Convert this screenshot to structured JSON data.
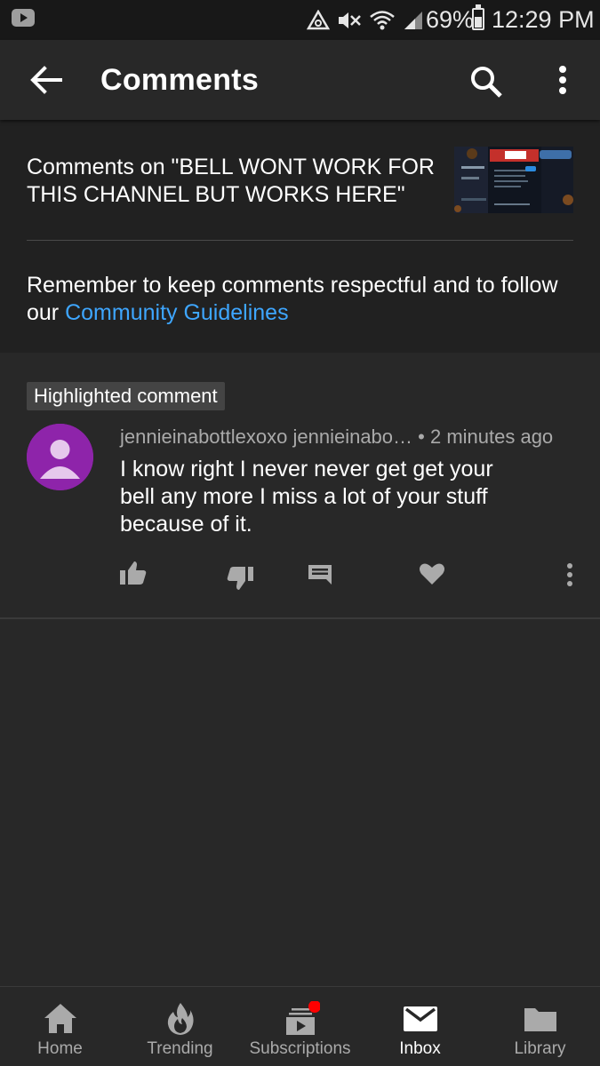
{
  "status_bar": {
    "battery": "69%",
    "time": "12:29 PM"
  },
  "app_bar": {
    "title": "Comments"
  },
  "header": {
    "video_title": "Comments on \"BELL WONT WORK FOR THIS CHANNEL BUT WORKS HERE\"",
    "notice_prefix": "Remember to keep comments respectful and to follow our ",
    "notice_link": "Community Guidelines"
  },
  "comment": {
    "badge": "Highlighted comment",
    "author": "jennieinabottlexoxo jennieinabo…",
    "separator": " • ",
    "time": "2 minutes ago",
    "text": "I know right I never never get get your bell any more I miss a lot of your stuff because of it."
  },
  "bottom_nav": {
    "tabs": [
      {
        "label": "Home",
        "icon": "home-icon"
      },
      {
        "label": "Trending",
        "icon": "trending-icon"
      },
      {
        "label": "Subscriptions",
        "icon": "subscriptions-icon"
      },
      {
        "label": "Inbox",
        "icon": "inbox-icon",
        "active": true
      },
      {
        "label": "Library",
        "icon": "library-icon"
      }
    ]
  },
  "colors": {
    "accent_link": "#3ea6ff",
    "avatar": "#8e24aa",
    "notification_dot": "#ff0000"
  }
}
